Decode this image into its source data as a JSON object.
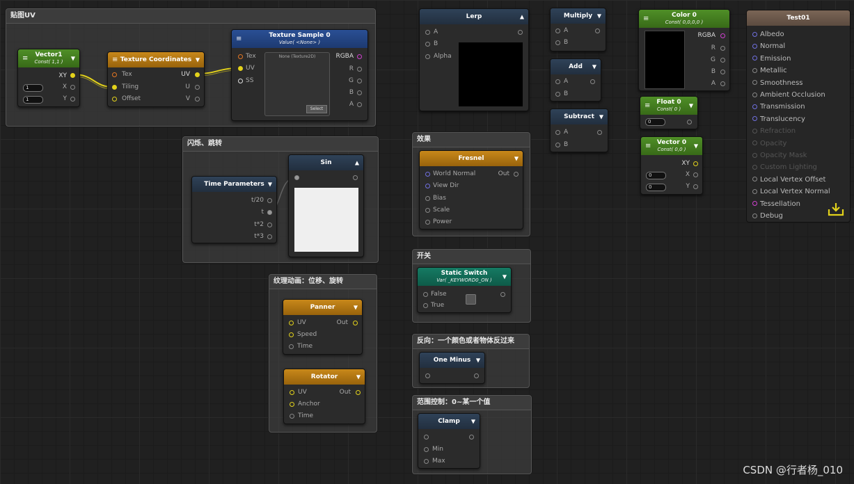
{
  "groups": {
    "uv": "贴图UV",
    "blink": "闪烁、跳转",
    "effect": "效果",
    "switch": "开关",
    "reverse": "反向：一个颜色或者物体反过来",
    "range": "范围控制：0~某一个值",
    "texanim": "纹理动画：位移、旋转"
  },
  "nodes": {
    "vector1": {
      "title": "Vector1",
      "sub": "Const( 1,1 )",
      "out": "XY",
      "x": "X",
      "y": "Y",
      "xval": "1",
      "yval": "1"
    },
    "texcoords": {
      "title": "Texture Coordinates",
      "tex": "Tex",
      "tiling": "Tiling",
      "offset": "Offset",
      "uv": "UV",
      "u": "U",
      "v": "V"
    },
    "texsample": {
      "title": "Texture Sample 0",
      "sub": "Value( <None> )",
      "tex": "Tex",
      "uv": "UV",
      "ss": "SS",
      "rgba": "RGBA",
      "r": "R",
      "g": "G",
      "b": "B",
      "a": "A",
      "preview": "None (Texture2D)",
      "select": "Select"
    },
    "lerp": {
      "title": "Lerp",
      "a": "A",
      "b": "B",
      "alpha": "Alpha"
    },
    "multiply": {
      "title": "Multiply",
      "a": "A",
      "b": "B"
    },
    "add": {
      "title": "Add",
      "a": "A",
      "b": "B"
    },
    "subtract": {
      "title": "Subtract",
      "a": "A",
      "b": "B"
    },
    "color0": {
      "title": "Color 0",
      "sub": "Const( 0,0,0,0 )",
      "rgba": "RGBA",
      "r": "R",
      "g": "G",
      "b": "B",
      "a": "A"
    },
    "float0": {
      "title": "Float 0",
      "sub": "Const( 0 )",
      "val": "0"
    },
    "vector0": {
      "title": "Vector 0",
      "sub": "Const( 0,0 )",
      "xy": "XY",
      "x": "X",
      "y": "Y",
      "xval": "0",
      "yval": "0"
    },
    "timeparams": {
      "title": "Time Parameters",
      "t20": "t/20",
      "t": "t",
      "t2": "t*2",
      "t3": "t*3"
    },
    "sin": {
      "title": "Sin"
    },
    "fresnel": {
      "title": "Fresnel",
      "worldnormal": "World Normal",
      "out": "Out",
      "viewdir": "View Dir",
      "bias": "Bias",
      "scale": "Scale",
      "power": "Power"
    },
    "staticswitch": {
      "title": "Static Switch",
      "sub": "Var( _KEYWORD0_ON )",
      "false": "False",
      "true": "True"
    },
    "oneminus": {
      "title": "One Minus"
    },
    "clamp": {
      "title": "Clamp",
      "min": "Min",
      "max": "Max"
    },
    "panner": {
      "title": "Panner",
      "uv": "UV",
      "out": "Out",
      "speed": "Speed",
      "time": "Time"
    },
    "rotator": {
      "title": "Rotator",
      "uv": "UV",
      "out": "Out",
      "anchor": "Anchor",
      "time": "Time"
    }
  },
  "output": {
    "title": "Test01",
    "inputs": [
      {
        "label": "Albedo",
        "enabled": true
      },
      {
        "label": "Normal",
        "enabled": true
      },
      {
        "label": "Emission",
        "enabled": true
      },
      {
        "label": "Metallic",
        "enabled": true
      },
      {
        "label": "Smoothness",
        "enabled": true
      },
      {
        "label": "Ambient Occlusion",
        "enabled": true
      },
      {
        "label": "Transmission",
        "enabled": true
      },
      {
        "label": "Translucency",
        "enabled": true
      },
      {
        "label": "Refraction",
        "enabled": false
      },
      {
        "label": "Opacity",
        "enabled": false
      },
      {
        "label": "Opacity Mask",
        "enabled": false
      },
      {
        "label": "Custom Lighting",
        "enabled": false
      },
      {
        "label": "Local Vertex Offset",
        "enabled": true
      },
      {
        "label": "Local Vertex Normal",
        "enabled": true
      },
      {
        "label": "Tessellation",
        "enabled": true
      },
      {
        "label": "Debug",
        "enabled": true
      }
    ]
  },
  "watermark": "CSDN @行者杨_010",
  "colors": {
    "wire": "#e3d21b",
    "background": "#202020"
  }
}
